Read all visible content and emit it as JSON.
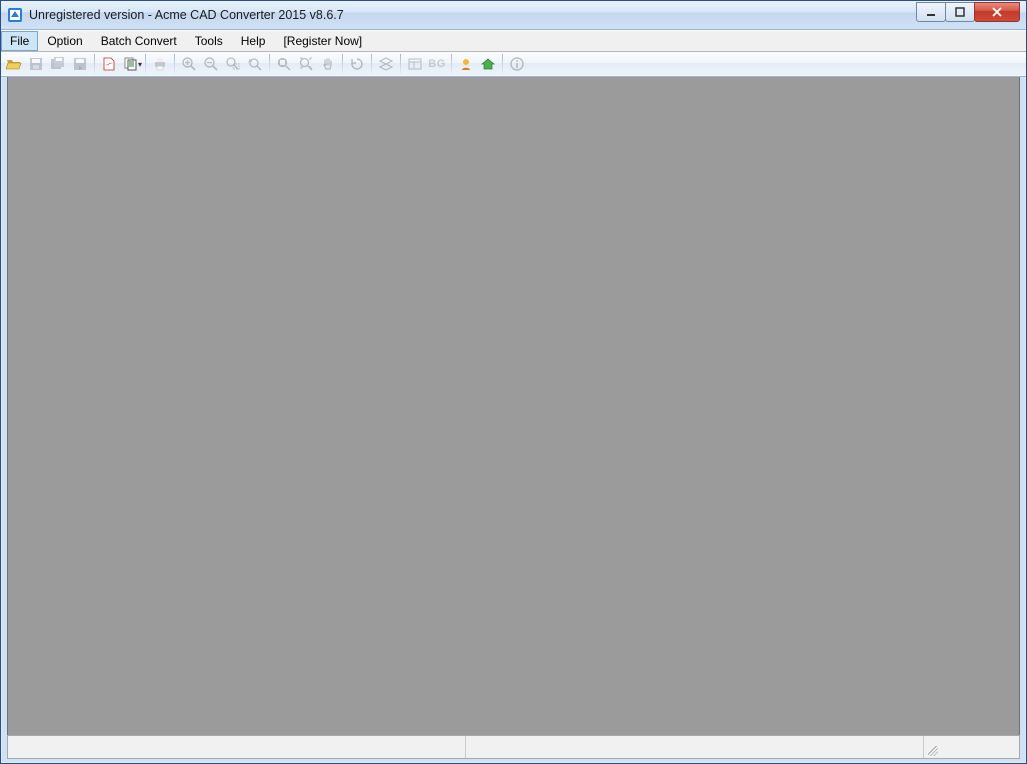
{
  "window": {
    "title": "Unregistered version - Acme CAD Converter 2015 v8.6.7"
  },
  "menubar": {
    "items": [
      {
        "label": "File"
      },
      {
        "label": "Option"
      },
      {
        "label": "Batch Convert"
      },
      {
        "label": "Tools"
      },
      {
        "label": "Help"
      },
      {
        "label": "[Register Now]"
      }
    ]
  },
  "toolbar": {
    "open": "Open",
    "save": "Save",
    "save_all": "Save All",
    "save_back": "Save Back",
    "pdf": "Export to PDF",
    "copy": "Copy",
    "print": "Print",
    "zoom_in": "Zoom In",
    "zoom_out": "Zoom Out",
    "zoom_window": "Zoom Window",
    "zoom_prev": "Zoom Previous",
    "zoom_extents": "Zoom Extents",
    "zoom_all": "Zoom All",
    "pan": "Pan",
    "regen": "Regen",
    "layers": "Layers",
    "layouts": "Layouts",
    "bg": "Background",
    "bg_label": "BG",
    "check_update": "Check Update",
    "home": "Home",
    "about": "About"
  },
  "statusbar": {
    "pane1": "",
    "pane2": ""
  }
}
